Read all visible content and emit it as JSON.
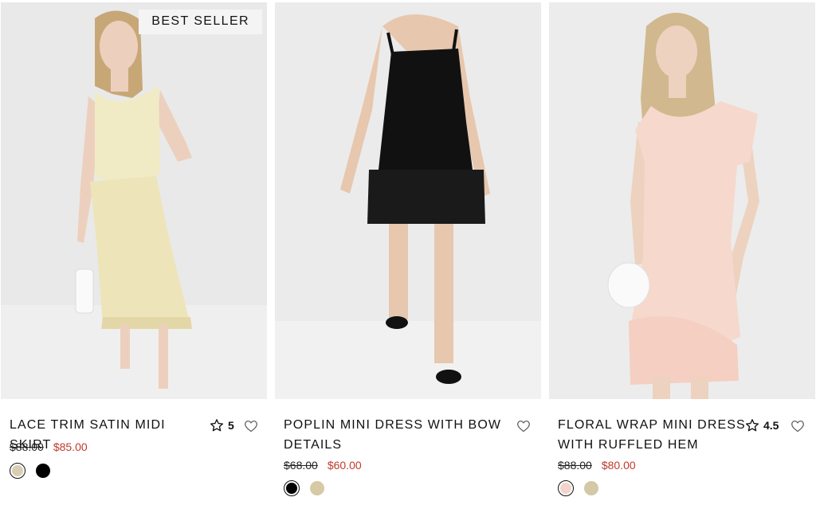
{
  "products": [
    {
      "badge": "BEST SELLER",
      "title": "LACE TRIM SATIN MIDI SKIRT",
      "rating": "5",
      "price_original": "$88.00",
      "price_sale": "$85.00",
      "swatches": [
        "#d8ceb3",
        "#000000"
      ],
      "dress_color": "#f1ebc5"
    },
    {
      "title": "POPLIN MINI DRESS WITH BOW DETAILS",
      "price_original": "$68.00",
      "price_sale": "$60.00",
      "swatches": [
        "#000000",
        "#d6c9a6"
      ],
      "dress_color": "#111111"
    },
    {
      "title": "FLORAL WRAP MINI DRESS WITH RUFFLED HEM",
      "rating": "4.5",
      "price_original": "$88.00",
      "price_sale": "$80.00",
      "swatches": [
        "#f2d4cc",
        "#d3c8a7"
      ],
      "dress_color": "#f6d8cc"
    }
  ],
  "colors": {
    "sale_price": "#c0392b",
    "text": "#111111",
    "photo_background": "#ececec"
  },
  "icons": {
    "rating": "star-outline-icon",
    "wishlist": "heart-outline-icon"
  }
}
